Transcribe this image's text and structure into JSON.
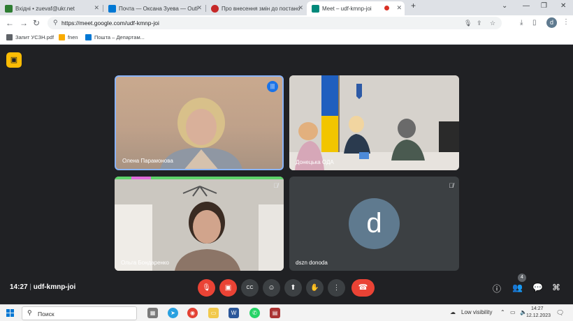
{
  "browser": {
    "tabs": [
      {
        "title": "Вхідні • zuevaf@ukr.net",
        "icon_color": "#2e7d32",
        "active": false
      },
      {
        "title": "Почта — Оксана Зуева — Outl",
        "icon_color": "#0078d4",
        "active": false
      },
      {
        "title": "Про внесення змін до постано",
        "icon_color": "#c62828",
        "active": false
      },
      {
        "title": "Meet – udf-kmnp-joi",
        "icon_color": "#00897b",
        "active": true
      }
    ],
    "new_tab_glyph": "+",
    "url": "https://meet.google.com/udf-kmnp-joi",
    "profile_initial": "d",
    "bookmarks": [
      {
        "label": "Запит УСЗН.pdf",
        "icon_color": "#5f6368"
      },
      {
        "label": "fnen",
        "icon_color": "#f9ab00"
      },
      {
        "label": "Пошта – Департам...",
        "icon_color": "#0078d4"
      }
    ]
  },
  "meet": {
    "participants": [
      {
        "name": "Олена Парамонова",
        "speaking": true,
        "muted": false
      },
      {
        "name": "Донецька ОДА",
        "speaking": false,
        "muted": false
      },
      {
        "name": "Ольга Бондаренко",
        "speaking": false,
        "muted": true
      },
      {
        "name": "dszn donoda",
        "speaking": false,
        "muted": true,
        "avatar_letter": "d"
      }
    ],
    "time": "14:27",
    "meeting_code": "udf-kmnp-joi",
    "people_count": "4",
    "controls": [
      "mic-off",
      "camera-off",
      "captions",
      "emoji",
      "present",
      "raise-hand",
      "more",
      "leave"
    ],
    "colors": {
      "background": "#202124",
      "danger": "#ea4335",
      "control": "#3c4043",
      "speaking_border": "#8ab4f8",
      "avatar": "#5f7a8f"
    }
  },
  "taskbar": {
    "search_placeholder": "Поиск",
    "visibility": "Low visibility",
    "time": "14:27",
    "date": "12.12.2023"
  }
}
